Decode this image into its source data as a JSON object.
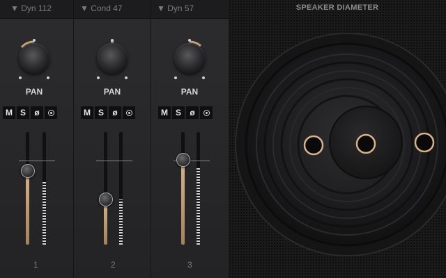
{
  "mixer": {
    "channels": [
      {
        "name": "▼ Dyn 112",
        "pan_label": "PAN",
        "buttons": {
          "mute": "M",
          "solo": "S",
          "phase": "ø"
        },
        "number": "1",
        "fader_level": 0.66,
        "meter_level": 0.57
      },
      {
        "name": "▼ Cond 47",
        "pan_label": "PAN",
        "buttons": {
          "mute": "M",
          "solo": "S",
          "phase": "ø"
        },
        "number": "2",
        "fader_level": 0.41,
        "meter_level": 0.4
      },
      {
        "name": "▼ Dyn 57",
        "pan_label": "PAN",
        "buttons": {
          "mute": "M",
          "solo": "S",
          "phase": "ø"
        },
        "number": "3",
        "fader_level": 0.76,
        "meter_level": 0.69
      }
    ]
  },
  "speaker": {
    "title": "SPEAKER DIAMETER",
    "mic_positions": 3
  },
  "colors": {
    "accent": "#d9b487",
    "background": "#262628"
  }
}
